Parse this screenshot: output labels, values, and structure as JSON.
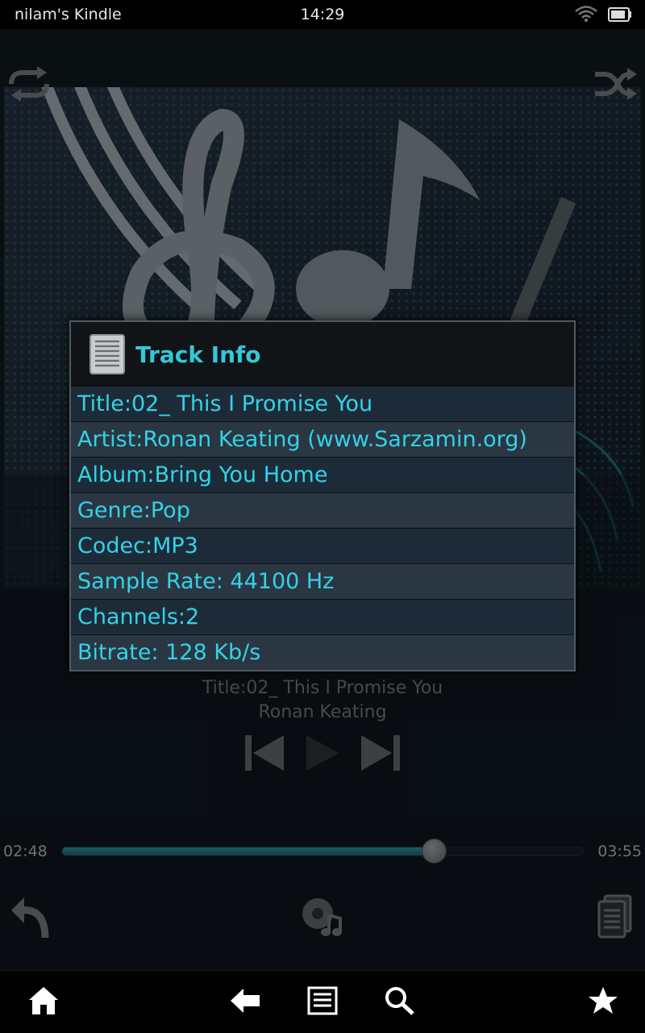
{
  "status_bar": {
    "device_name": "nilam's Kindle",
    "time": "14:29",
    "wifi_icon": "wifi-icon",
    "battery_icon": "battery-icon"
  },
  "player": {
    "repeat_icon": "repeat-icon",
    "shuffle_icon": "shuffle-icon",
    "now_playing_title": "Title:02_ This I Promise You",
    "now_playing_artist": "Ronan Keating",
    "elapsed": "02:48",
    "duration": "03:55",
    "progress": 0.715,
    "controls": [
      "previous-icon",
      "play-icon",
      "next-icon"
    ],
    "bottom_actions": [
      "back-arrow-icon",
      "visualizer-icon",
      "playlist-icon"
    ]
  },
  "dialog": {
    "title": "Track Info",
    "icon": "document-icon",
    "rows": [
      "Title:02_ This I Promise You",
      "Artist:Ronan Keating (www.Sarzamin.org)",
      "Album:Bring You Home",
      "Genre:Pop",
      "Codec:MP3",
      "Sample Rate: 44100 Hz",
      "Channels:2",
      "Bitrate: 128 Kb/s"
    ]
  },
  "navbar": {
    "items": [
      "home-icon",
      "back-icon",
      "menu-icon",
      "search-icon",
      "favorites-icon"
    ]
  },
  "colors": {
    "accent": "#33d3e6",
    "dialog_bg": "#1c2126",
    "row_odd": "#1d2b39",
    "row_even": "#2b3643",
    "seek_fill": "#2e8c97"
  }
}
